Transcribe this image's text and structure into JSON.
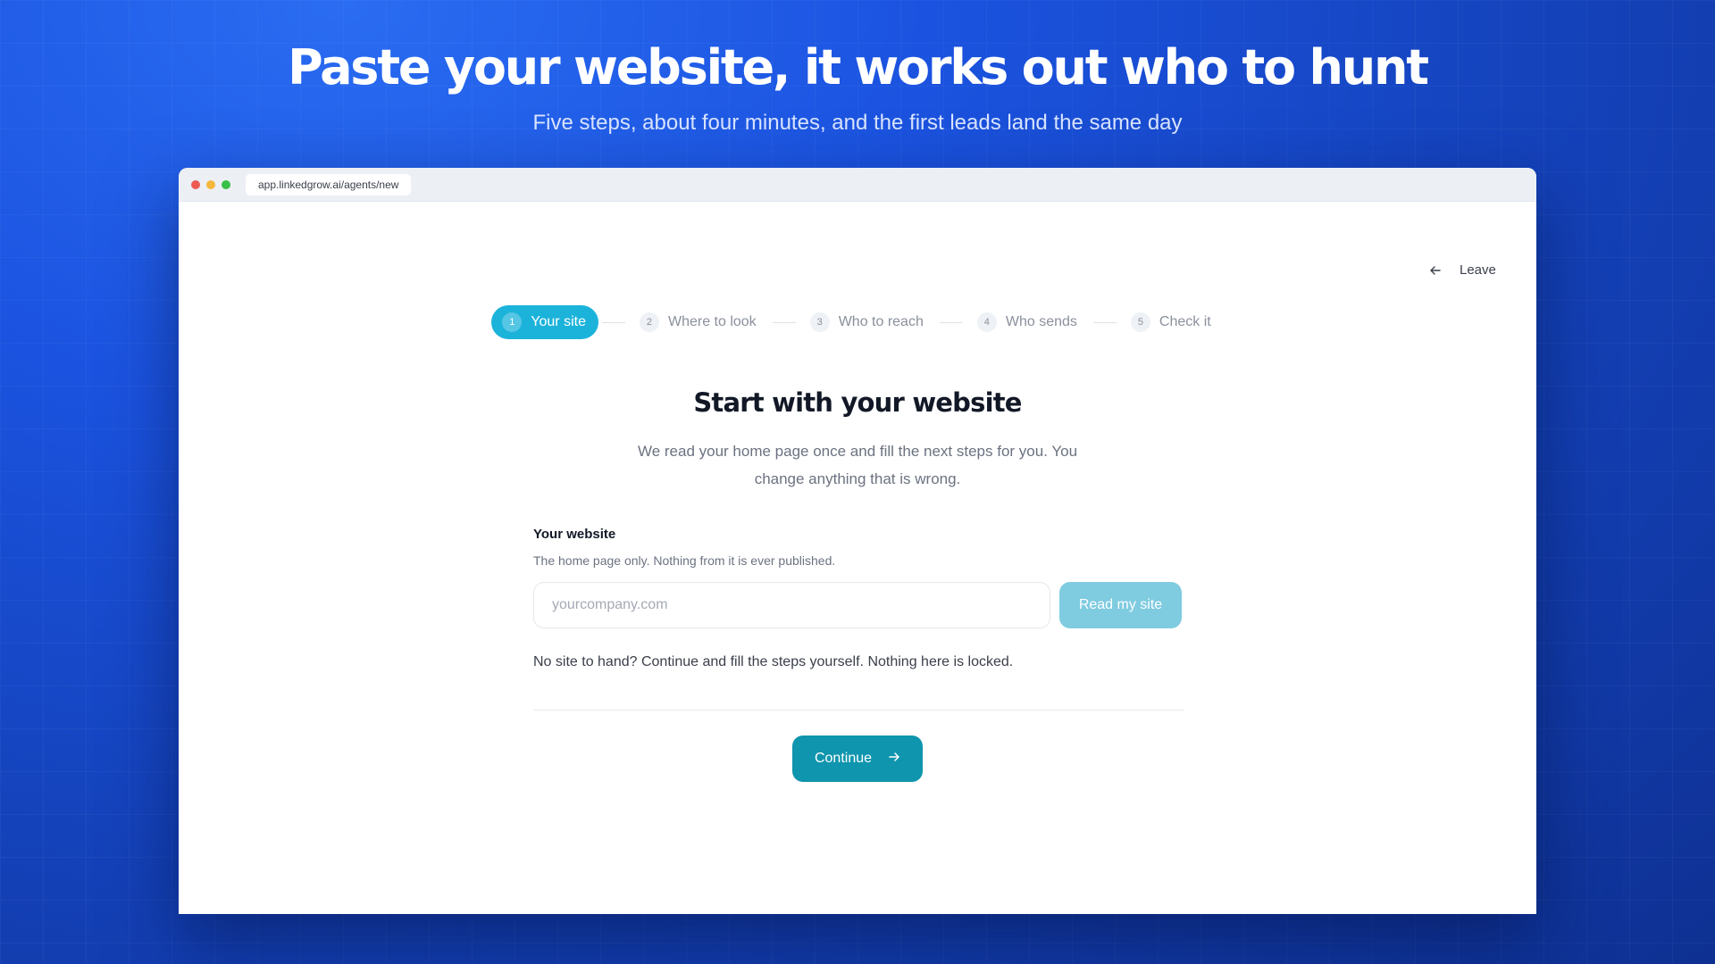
{
  "hero": {
    "title": "Paste your website, it works out who to hunt",
    "subtitle": "Five steps, about four minutes, and the first leads land the same day"
  },
  "browser": {
    "url": "app.linkedgrow.ai/agents/new"
  },
  "header": {
    "leave_label": "Leave",
    "leave_icon": "arrow-left-icon"
  },
  "stepper": {
    "steps": [
      {
        "number": "1",
        "label": "Your site",
        "active": true
      },
      {
        "number": "2",
        "label": "Where to look",
        "active": false
      },
      {
        "number": "3",
        "label": "Who to reach",
        "active": false
      },
      {
        "number": "4",
        "label": "Who sends",
        "active": false
      },
      {
        "number": "5",
        "label": "Check it",
        "active": false
      }
    ]
  },
  "main": {
    "title": "Start with your website",
    "description": "We read your home page once and fill the next steps for you. You change anything that is wrong.",
    "field_label": "Your website",
    "field_help": "The home page only. Nothing from it is ever published.",
    "input_value": "",
    "input_placeholder": "yourcompany.com",
    "read_button": "Read my site",
    "no_site_note": "No site to hand? Continue and fill the steps yourself. Nothing here is locked.",
    "continue_button": "Continue",
    "continue_icon": "arrow-right-icon"
  },
  "colors": {
    "accent": "#1cb3db",
    "primary_button": "#0f95ad",
    "disabled_button": "#7fcbe0",
    "background": "#1b53e0"
  }
}
